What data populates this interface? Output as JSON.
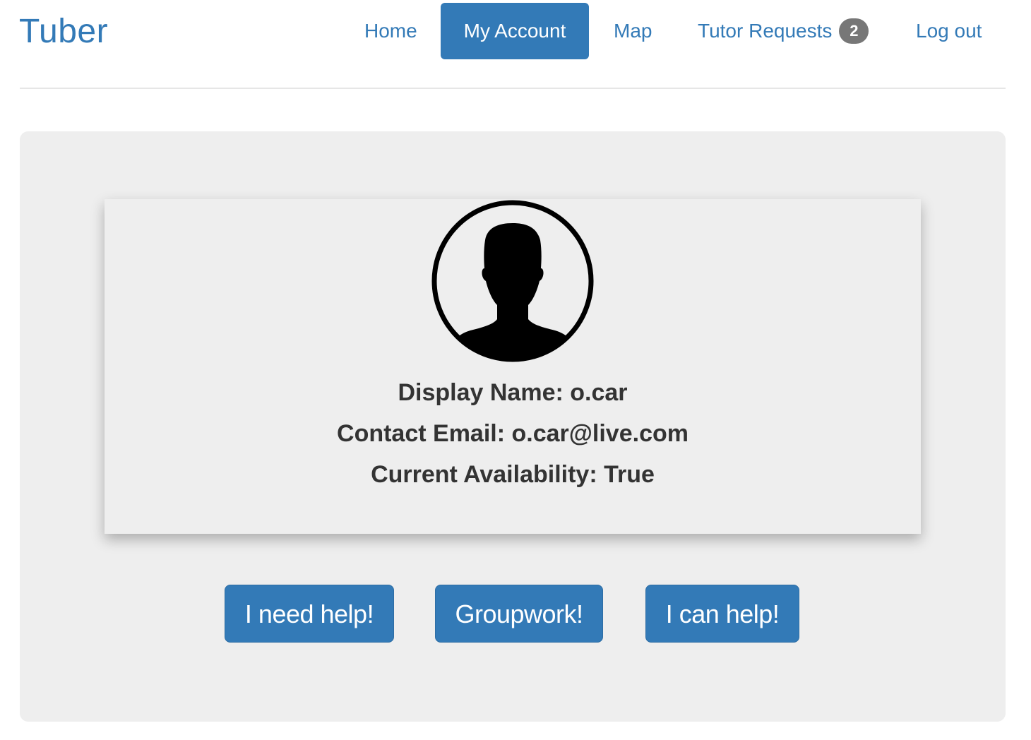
{
  "brand": "Tuber",
  "nav": {
    "home": "Home",
    "my_account": "My Account",
    "map": "Map",
    "tutor_requests": "Tutor Requests",
    "tutor_requests_badge": "2",
    "log_out": "Log out"
  },
  "profile": {
    "avatar_icon": "user-silhouette-icon",
    "display_name": "Display Name: o.car",
    "contact_email": "Contact Email: o.car@live.com",
    "availability": "Current Availability: True"
  },
  "actions": {
    "need_help": "I need help!",
    "groupwork": "Groupwork!",
    "can_help": "I can help!"
  },
  "colors": {
    "primary": "#337ab7",
    "badge": "#777777",
    "panel": "#eeeeee",
    "text": "#333333"
  }
}
